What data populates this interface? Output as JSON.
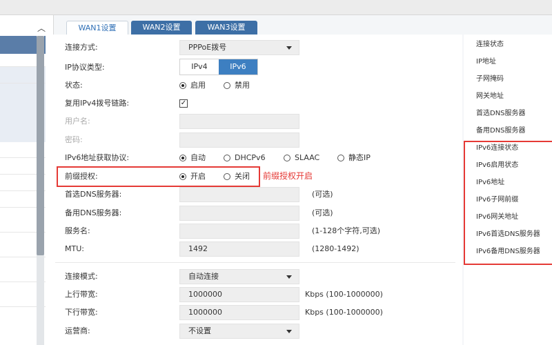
{
  "tabs": [
    {
      "label": "WAN1设置"
    },
    {
      "label": "WAN2设置"
    },
    {
      "label": "WAN3设置"
    }
  ],
  "form": {
    "conn_type": {
      "label": "连接方式:",
      "value": "PPPoE拨号"
    },
    "ip_proto": {
      "label": "IP协议类型:",
      "options": [
        "IPv4",
        "IPv6"
      ],
      "selected": "IPv6"
    },
    "status": {
      "label": "状态:",
      "options": [
        "启用",
        "禁用"
      ],
      "selected": "启用"
    },
    "reuse_ipv4": {
      "label": "复用IPv4拨号链路:",
      "checked": true,
      "check_glyph": "✓"
    },
    "username": {
      "label": "用户名:",
      "value": ""
    },
    "password": {
      "label": "密码:",
      "value": ""
    },
    "ipv6_addr_proto": {
      "label": "IPv6地址获取协议:",
      "options": [
        "自动",
        "DHCPv6",
        "SLAAC",
        "静态IP"
      ],
      "selected": "自动"
    },
    "prefix_deleg": {
      "label": "前缀授权:",
      "options": [
        "开启",
        "关闭"
      ],
      "selected": "开启"
    },
    "primary_dns": {
      "label": "首选DNS服务器:",
      "value": "",
      "hint": "(可选)"
    },
    "backup_dns": {
      "label": "备用DNS服务器:",
      "value": "",
      "hint": "(可选)"
    },
    "service_name": {
      "label": "服务名:",
      "value": "",
      "hint": "(1-128个字符,可选)"
    },
    "mtu": {
      "label": "MTU:",
      "value": "1492",
      "hint": "(1280-1492)"
    },
    "conn_mode": {
      "label": "连接模式:",
      "value": "自动连接"
    },
    "up_bw": {
      "label": "上行带宽:",
      "value": "1000000",
      "hint": "Kbps (100-1000000)"
    },
    "down_bw": {
      "label": "下行带宽:",
      "value": "1000000",
      "hint": "Kbps (100-1000000)"
    },
    "isp": {
      "label": "运营商:",
      "value": "不设置"
    }
  },
  "annotation": {
    "text": "前缀授权开启",
    "color": "#e53935"
  },
  "status_panel": {
    "items": [
      "连接状态",
      "IP地址",
      "子网掩码",
      "网关地址",
      "首选DNS服务器",
      "备用DNS服务器"
    ],
    "ipv6_items": [
      "IPv6连接状态",
      "IPv6启用状态",
      "IPv6地址",
      "IPv6子网前缀",
      "IPv6网关地址",
      "IPv6首选DNS服务器",
      "IPv6备用DNS服务器"
    ]
  },
  "sidebar": {
    "collapse_glyph": "︿"
  },
  "colors": {
    "accent": "#3d7fc1",
    "tab_inactive": "#3d6fa6",
    "highlight": "#e53935"
  }
}
